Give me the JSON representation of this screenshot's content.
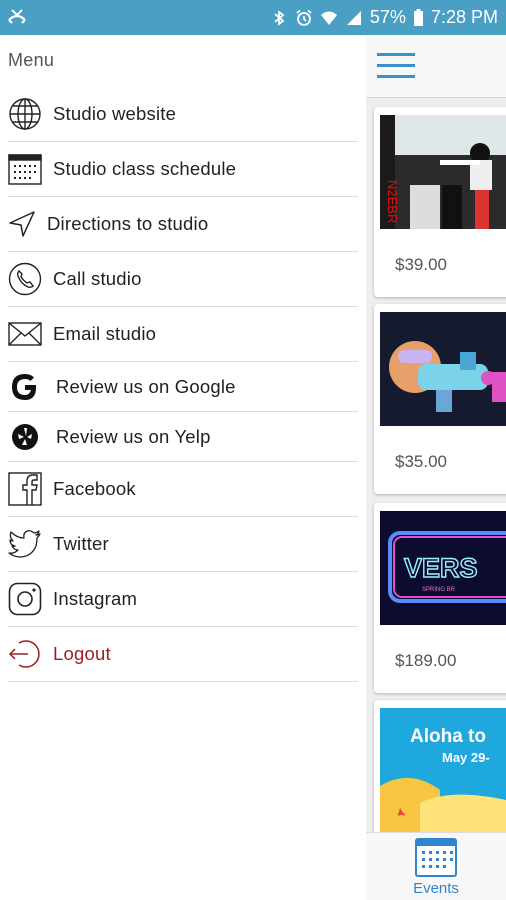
{
  "status_bar": {
    "battery": "57%",
    "time": "7:28 PM",
    "bg_color": "#4a9fc4"
  },
  "drawer": {
    "title": "Menu",
    "items": [
      {
        "label": "Studio website",
        "icon": "globe-icon"
      },
      {
        "label": "Studio class schedule",
        "icon": "calendar-icon"
      },
      {
        "label": "Directions to studio",
        "icon": "navigation-arrow-icon"
      },
      {
        "label": "Call studio",
        "icon": "phone-icon"
      },
      {
        "label": "Email studio",
        "icon": "envelope-icon"
      },
      {
        "label": "Review us on Google",
        "icon": "google-icon"
      },
      {
        "label": "Review us on Yelp",
        "icon": "yelp-icon"
      },
      {
        "label": "Facebook",
        "icon": "facebook-icon"
      },
      {
        "label": "Twitter",
        "icon": "twitter-icon"
      },
      {
        "label": "Instagram",
        "icon": "instagram-icon"
      },
      {
        "label": "Logout",
        "icon": "logout-icon",
        "color": "#9a1f1f"
      }
    ]
  },
  "content": {
    "events": [
      {
        "price": "$39.00"
      },
      {
        "price": "$35.00"
      },
      {
        "price": "$189.00"
      },
      {
        "banner_text": "Aloha to",
        "banner_subtext": "May 29-"
      }
    ],
    "version_banner_text": "VERS",
    "bottom_nav": {
      "events_label": "Events"
    },
    "accent_color": "#3a8fd0"
  }
}
